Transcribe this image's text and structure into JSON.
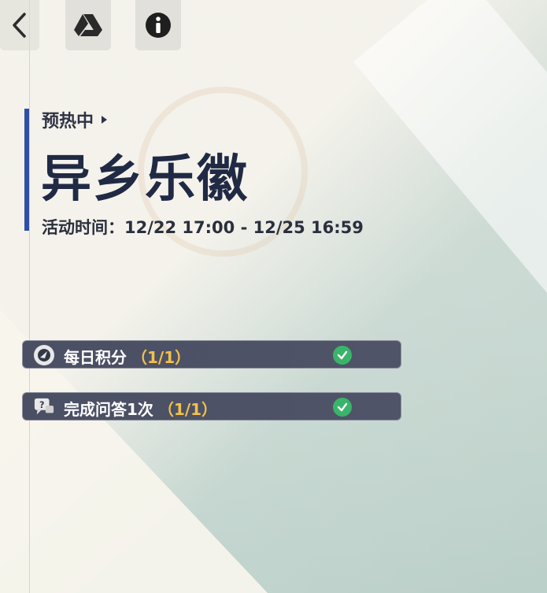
{
  "header": {
    "back_icon": "back-chevron-icon",
    "drive_icon": "google-drive-icon",
    "info_icon": "info-icon"
  },
  "event": {
    "status": "预热中",
    "title": "异乡乐徽",
    "time_label": "活动时间：",
    "time_range": "12/22 17:00 - 12/25 16:59"
  },
  "tasks": [
    {
      "icon": "daily-points-icon",
      "label": "每日积分",
      "progress": "（1/1）",
      "completed": true
    },
    {
      "icon": "question-chat-icon",
      "label": "完成问答1次",
      "progress": "（1/1）",
      "completed": true
    }
  ],
  "colors": {
    "accent": "#2f4ea7",
    "task_bg": "#4b4f63",
    "progress": "#f3c14a",
    "check": "#3ab46a"
  }
}
